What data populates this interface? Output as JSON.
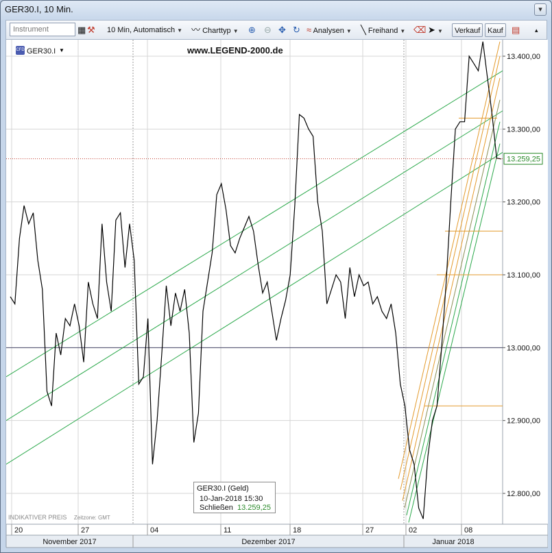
{
  "window": {
    "title": "GER30.I, 10 Min.",
    "buttons": [
      "▾"
    ]
  },
  "toolbar": {
    "instrument_placeholder": "Instrument",
    "timeframe": "10 Min,",
    "scaling": "Automatisch",
    "charttype": "Charttyp",
    "analysen": "Analysen",
    "freihand": "Freihand",
    "verkauf": "Verkauf",
    "kauf": "Kauf"
  },
  "chart_header": {
    "symbol": "GER30.I",
    "symbol_icon": "CFD",
    "watermark": "www.LEGEND-2000.de"
  },
  "infobox": {
    "title": "GER30.I (Geld)",
    "datetime": "10-Jan-2018 15:30",
    "close_label": "Schließen",
    "close_value": "13.259,25"
  },
  "footer": {
    "indicative": "INDIKATIVER PREIS",
    "timezone": "Zeitzone: GMT"
  },
  "chart_data": {
    "type": "line",
    "title": "",
    "ylim": [
      12750,
      13460
    ],
    "y_ticks": [
      "13.400,00",
      "13.300,00",
      "13.200,00",
      "13.100,00",
      "13.000,00",
      "12.900,00",
      "12.800,00"
    ],
    "y_tick_values": [
      13400,
      13300,
      13200,
      13100,
      13000,
      12900,
      12800
    ],
    "x_ticks": [
      "20",
      "27",
      "04",
      "11",
      "18",
      "27",
      "02",
      "08"
    ],
    "x_groups": [
      "November 2017",
      "Dezember 2017",
      "Januar 2018"
    ],
    "current_price_label": "13.259,25",
    "current_price": 13259.25,
    "reference_line": 13000,
    "series": [
      {
        "values": [
          13070,
          13060,
          13150,
          13195,
          13170,
          13185,
          13120,
          13080,
          12940,
          12920,
          13020,
          12990,
          13040,
          13030,
          13060,
          13030,
          12980,
          13090,
          13060,
          13040,
          13170,
          13090,
          13050,
          13175,
          13185,
          13110,
          13170,
          13120,
          12950,
          12960,
          13040,
          12840,
          12900,
          12990,
          13085,
          13030,
          13075,
          13050,
          13080,
          13020,
          12870,
          12910,
          13050,
          13090,
          13130,
          13210,
          13225,
          13190,
          13140,
          13130,
          13150,
          13165,
          13180,
          13160,
          13115,
          13075,
          13090,
          13050,
          13010,
          13040,
          13065,
          13100,
          13195,
          13320,
          13315,
          13300,
          13290,
          13200,
          13160,
          13060,
          13080,
          13100,
          13090,
          13040,
          13110,
          13070,
          13100,
          13085,
          13090,
          13060,
          13070,
          13050,
          13040,
          13060,
          13020,
          12950,
          12920,
          12860,
          12840,
          12780,
          12765,
          12850,
          12900,
          12920,
          13000,
          13090,
          13200,
          13300,
          13310,
          13310,
          13400,
          13390,
          13380,
          13420,
          13370,
          13320,
          13260,
          13259
        ]
      }
    ]
  },
  "colors": {
    "price_line": "#000000",
    "green_channel": "#2aa84a",
    "fib_orange": "#e39a2c",
    "current_price_dotted": "#c0392b",
    "current_price_badge_text": "#2a8a2a"
  }
}
